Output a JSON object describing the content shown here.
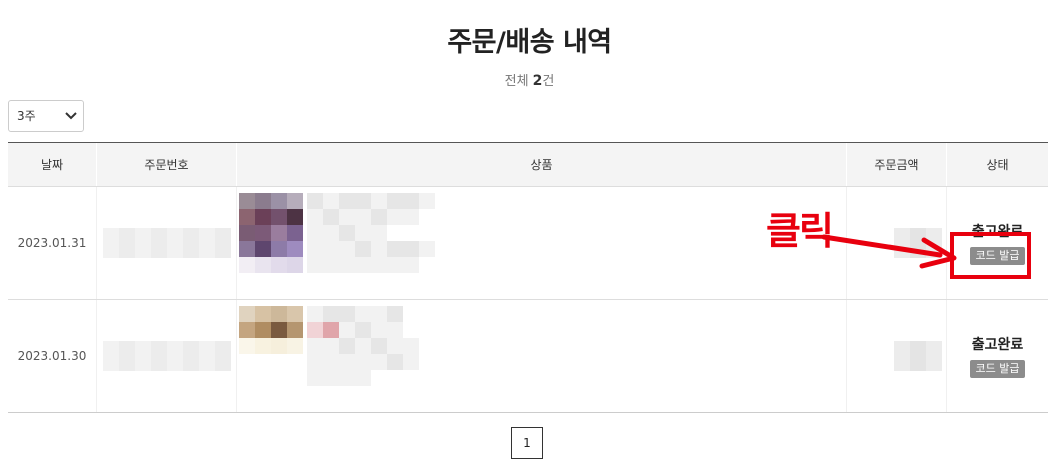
{
  "page": {
    "title": "주문/배송 내역",
    "count_prefix": "전체 ",
    "count_value": "2",
    "count_suffix": "건"
  },
  "filter": {
    "period_selected": "3주"
  },
  "table": {
    "headers": [
      "날짜",
      "주문번호",
      "상품",
      "주문금액",
      "상태"
    ],
    "rows": [
      {
        "date": "2023.01.31",
        "status": "출고완료",
        "action": "코드 발급"
      },
      {
        "date": "2023.01.30",
        "status": "출고완료",
        "action": "코드 발급"
      }
    ]
  },
  "annotation": {
    "label": "클릭",
    "color": "#e8000e"
  },
  "pagination": {
    "current_page": "1"
  },
  "colors": {
    "header_bg": "#f4f4f4",
    "button_bg": "#8c8c8c",
    "highlight": "#e8000e"
  }
}
